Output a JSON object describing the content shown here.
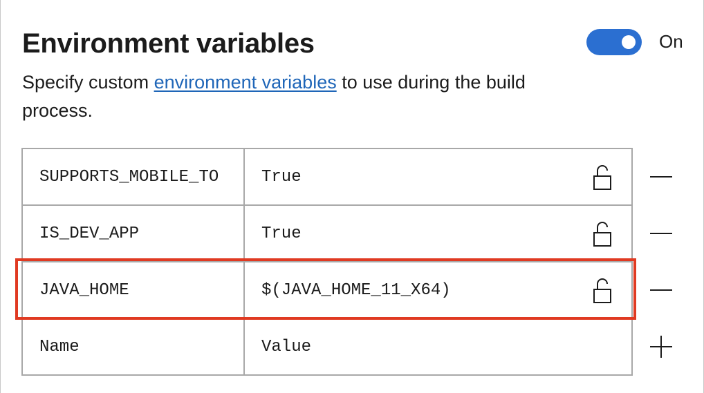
{
  "header": {
    "title": "Environment variables",
    "toggle_label": "On",
    "toggle_on": true
  },
  "description": {
    "before": "Specify custom ",
    "link": "environment variables",
    "after": " to use during the build process."
  },
  "variables": [
    {
      "name": "SUPPORTS_MOBILE_TO",
      "value": "True"
    },
    {
      "name": "IS_DEV_APP",
      "value": "True"
    },
    {
      "name": "JAVA_HOME",
      "value": "$(JAVA_HOME_11_X64)"
    }
  ],
  "new_row": {
    "name_placeholder": "Name",
    "value_placeholder": "Value"
  },
  "colors": {
    "accent": "#2b6fd1",
    "link": "#1f66b8",
    "highlight": "#e03a22"
  },
  "icons": {
    "lock": "unlocked-padlock-icon",
    "remove": "minus-icon",
    "add": "plus-icon"
  }
}
